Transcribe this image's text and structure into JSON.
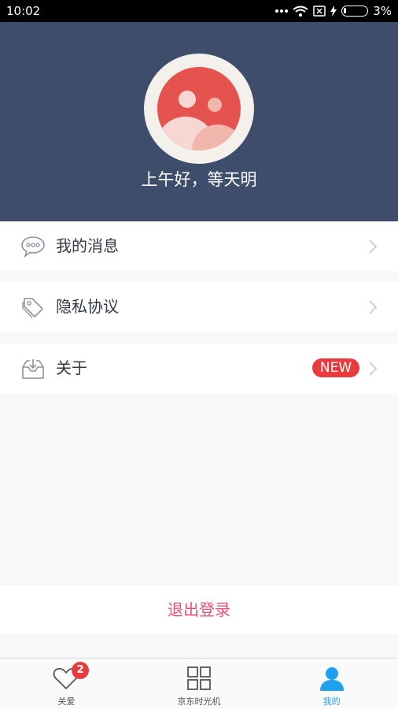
{
  "status_bar": {
    "time": "10:02",
    "battery": "3%"
  },
  "profile": {
    "greeting": "上午好，等天明"
  },
  "menu": {
    "messages": {
      "label": "我的消息"
    },
    "privacy": {
      "label": "隐私协议"
    },
    "about": {
      "label": "关于",
      "badge": "NEW"
    }
  },
  "logout": {
    "label": "退出登录"
  },
  "tabbar": {
    "care": {
      "label": "关爱",
      "badge": "2"
    },
    "time_machine": {
      "label": "京东时光机"
    },
    "mine": {
      "label": "我的"
    }
  },
  "colors": {
    "header_bg": "#3d4d6b",
    "accent": "#1ea0f0",
    "badge": "#e93b3d",
    "logout": "#ef4f6e"
  }
}
